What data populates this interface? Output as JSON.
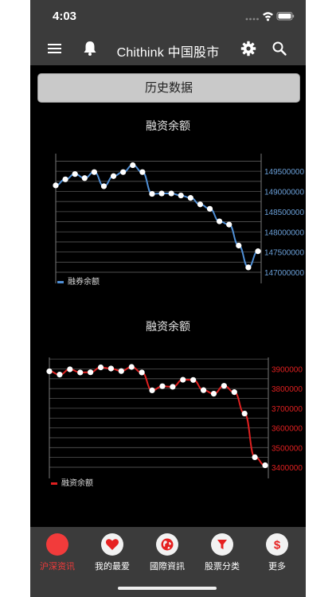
{
  "status_bar": {
    "time": "4:03"
  },
  "nav": {
    "title": "Chithink 中国股市"
  },
  "history_button": {
    "label": "历史数据"
  },
  "chart_data": [
    {
      "type": "line",
      "title": "融资余额",
      "series": [
        {
          "name": "融券余额",
          "color": "#4f8fd6",
          "values": [
            149150000,
            149300000,
            149430000,
            149330000,
            149480000,
            149130000,
            149380000,
            149480000,
            149650000,
            149480000,
            148940000,
            148950000,
            148950000,
            148900000,
            148840000,
            148680000,
            148570000,
            148260000,
            148180000,
            147660000,
            147120000,
            147520000
          ]
        }
      ],
      "ylim": [
        147000000,
        149700000
      ],
      "yticks": [
        {
          "value": 149500000,
          "label": "149500000"
        },
        {
          "value": 149000000,
          "label": "149000000"
        },
        {
          "value": 148500000,
          "label": "148500000"
        },
        {
          "value": 148000000,
          "label": "148000000"
        },
        {
          "value": 147500000,
          "label": "147500000"
        },
        {
          "value": 147000000,
          "label": "147000000"
        }
      ],
      "tick_color": "#6a9fd8",
      "grid": true,
      "legend": "bottom-left"
    },
    {
      "type": "line",
      "title": "融资余额",
      "series": [
        {
          "name": "融资余额",
          "color": "#e02020",
          "values": [
            3888000,
            3871000,
            3898000,
            3882000,
            3883000,
            3908000,
            3902000,
            3889000,
            3910000,
            3882000,
            3791000,
            3812000,
            3809000,
            3845000,
            3844000,
            3792000,
            3774000,
            3814000,
            3782000,
            3673000,
            3451000,
            3410000
          ]
        }
      ],
      "ylim": [
        3400000,
        3910000
      ],
      "yticks": [
        {
          "value": 3900000,
          "label": "3900000"
        },
        {
          "value": 3800000,
          "label": "3800000"
        },
        {
          "value": 3700000,
          "label": "3700000"
        },
        {
          "value": 3600000,
          "label": "3600000"
        },
        {
          "value": 3500000,
          "label": "3500000"
        },
        {
          "value": 3400000,
          "label": "3400000"
        }
      ],
      "tick_color": "#e02020",
      "grid": true,
      "legend": "bottom-left"
    }
  ],
  "tabs": [
    {
      "label": "沪深资讯",
      "icon": "circle-icon",
      "active": true
    },
    {
      "label": "我的最爱",
      "icon": "heart-icon",
      "active": false
    },
    {
      "label": "國際資訊",
      "icon": "globe-icon",
      "active": false
    },
    {
      "label": "股票分类",
      "icon": "filter-icon",
      "active": false
    },
    {
      "label": "更多",
      "icon": "dollar-icon",
      "active": false
    }
  ],
  "colors": {
    "active": "#f23b3b",
    "bar": "#3b3b3b",
    "background": "#000000"
  }
}
